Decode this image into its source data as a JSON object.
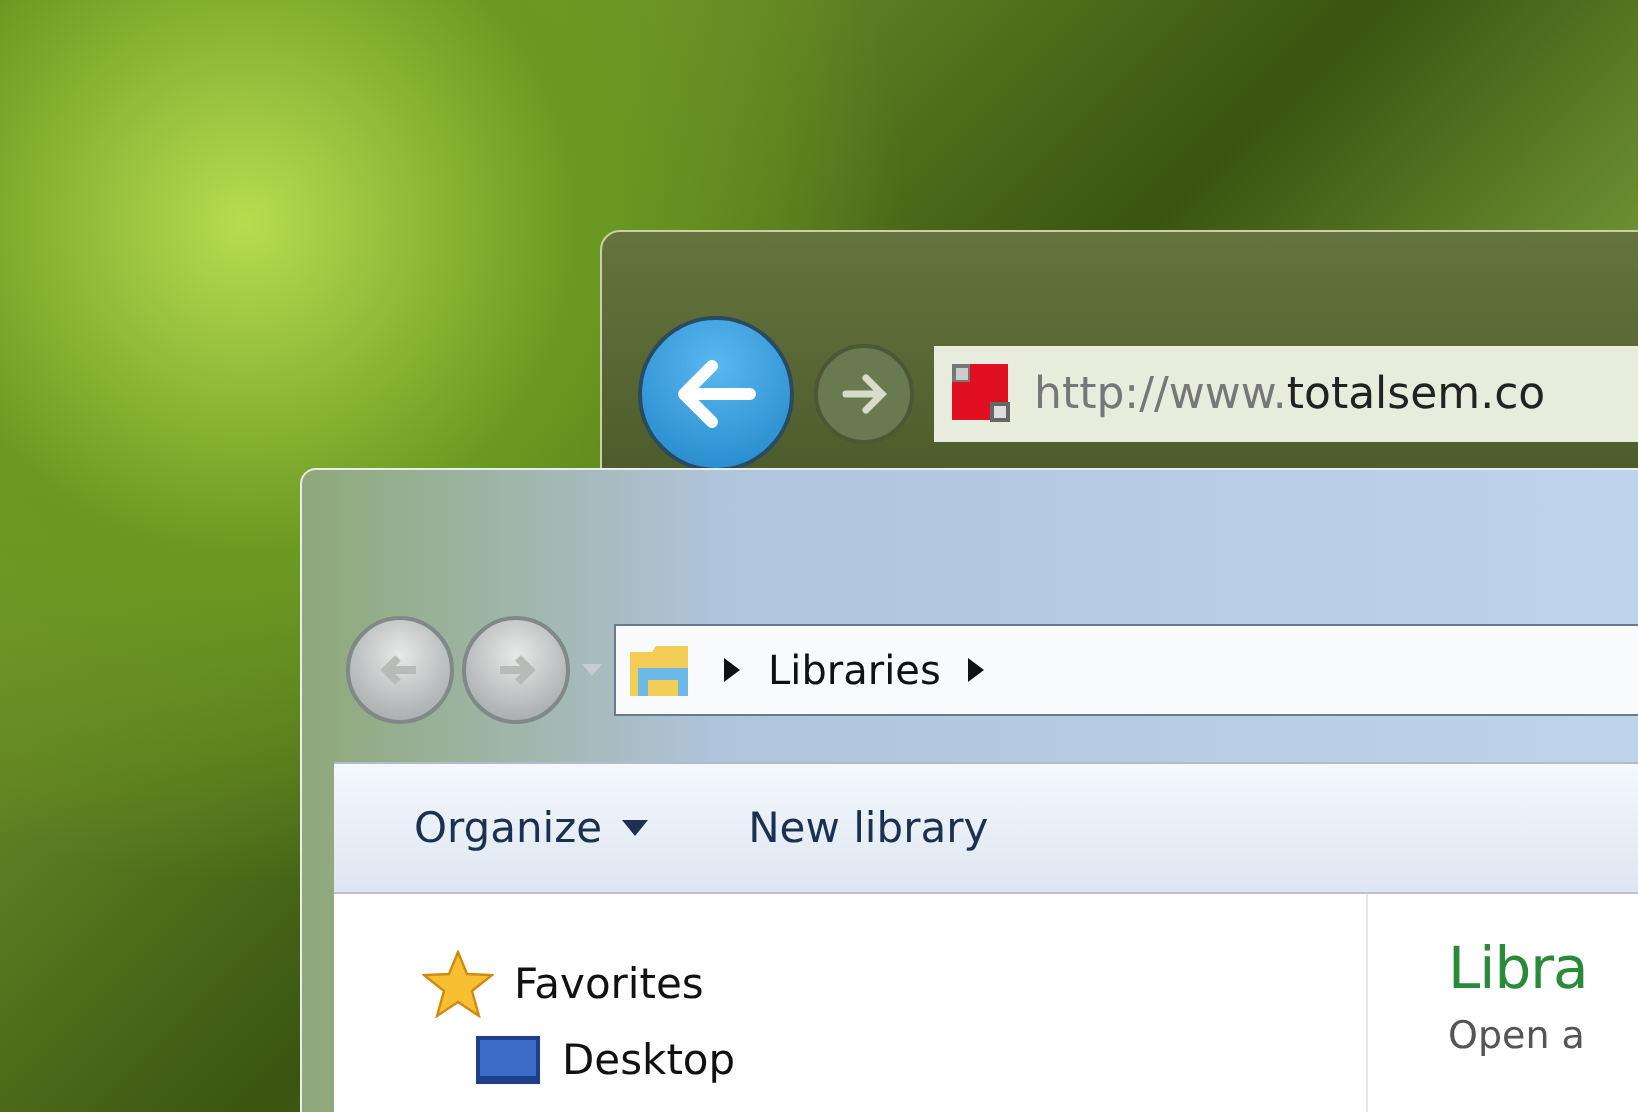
{
  "browser": {
    "address": {
      "prefix": "http://www.",
      "domain": "totalsem.co"
    }
  },
  "explorer": {
    "breadcrumb": [
      "Libraries"
    ],
    "toolbar": [
      {
        "label": "Organize",
        "kind": "menu"
      },
      {
        "label": "New library",
        "kind": "button"
      }
    ],
    "nav": [
      {
        "label": "Favorites",
        "kind": "star"
      },
      {
        "label": "Desktop",
        "kind": "desktop"
      }
    ],
    "content": {
      "title": "Libra",
      "subtitle": "Open a"
    }
  }
}
